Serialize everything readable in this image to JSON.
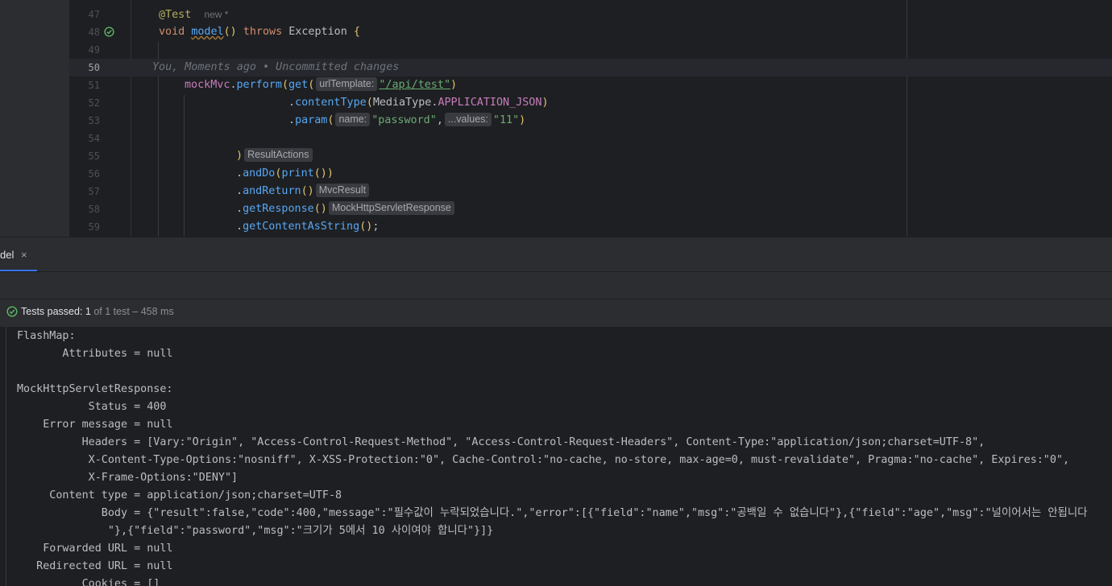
{
  "editor": {
    "lines": [
      {
        "num": "47",
        "code": "@Test",
        "new_tag": "new *"
      },
      {
        "num": "48",
        "code_kw": "void",
        "code_fn": "model",
        "code_rest": "() ",
        "code_throws": "throws",
        "code_exc": " Exception ",
        "code_brace": "{"
      },
      {
        "num": "49"
      },
      {
        "num": "50",
        "blame": "You, Moments ago • Uncommitted changes"
      },
      {
        "num": "51",
        "obj": "mockMvc",
        "dot": ".",
        "m1": "perform",
        "p1": "(",
        "m2": "get",
        "p2": "(",
        "hint": "urlTemplate:",
        "str": "\"/api/test\"",
        "p3": ")"
      },
      {
        "num": "52",
        "dot": ".",
        "m": "contentType",
        "p1": "(",
        "cls": "MediaType",
        "dot2": ".",
        "fld": "APPLICATION_JSON",
        "p2": ")"
      },
      {
        "num": "53",
        "dot": ".",
        "m": "param",
        "p1": "(",
        "hint1": "name:",
        "str1": "\"password\"",
        "comma": ",",
        "hint2": "...values:",
        "str2": "\"11\"",
        "p2": ")"
      },
      {
        "num": "54"
      },
      {
        "num": "55",
        "p": ")",
        "hint": "ResultActions"
      },
      {
        "num": "56",
        "dot": ".",
        "m1": "andDo",
        "p1": "(",
        "m2": "print",
        "p2": "()",
        "p3": ")"
      },
      {
        "num": "57",
        "dot": ".",
        "m": "andReturn",
        "p": "()",
        "hint": "MvcResult"
      },
      {
        "num": "58",
        "dot": ".",
        "m": "getResponse",
        "p": "()",
        "hint": "MockHttpServletResponse"
      },
      {
        "num": "59",
        "dot": ".",
        "m": "getContentAsString",
        "p": "()",
        "semi": ";"
      }
    ]
  },
  "tab": {
    "label": "del",
    "close": "×"
  },
  "status": {
    "passed": "Tests passed:",
    "count": "1",
    "detail": "of 1 test – 458 ms"
  },
  "console": [
    "FlashMap:",
    "       Attributes = null",
    "",
    "MockHttpServletResponse:",
    "           Status = 400",
    "    Error message = null",
    "          Headers = [Vary:\"Origin\", \"Access-Control-Request-Method\", \"Access-Control-Request-Headers\", Content-Type:\"application/json;charset=UTF-8\",",
    "           X-Content-Type-Options:\"nosniff\", X-XSS-Protection:\"0\", Cache-Control:\"no-cache, no-store, max-age=0, must-revalidate\", Pragma:\"no-cache\", Expires:\"0\",",
    "           X-Frame-Options:\"DENY\"]",
    "     Content type = application/json;charset=UTF-8",
    "             Body = {\"result\":false,\"code\":400,\"message\":\"필수값이 누락되었습니다.\",\"error\":[{\"field\":\"name\",\"msg\":\"공백일 수 없습니다\"},{\"field\":\"age\",\"msg\":\"널이어서는 안됩니다",
    "              \"},{\"field\":\"password\",\"msg\":\"크기가 5에서 10 사이여야 합니다\"}]}",
    "    Forwarded URL = null",
    "   Redirected URL = null",
    "          Cookies = []"
  ],
  "colors": {
    "accent": "#3574f0",
    "pass": "#5fb865",
    "bg": "#1e1f22",
    "panel": "#2b2d30"
  }
}
